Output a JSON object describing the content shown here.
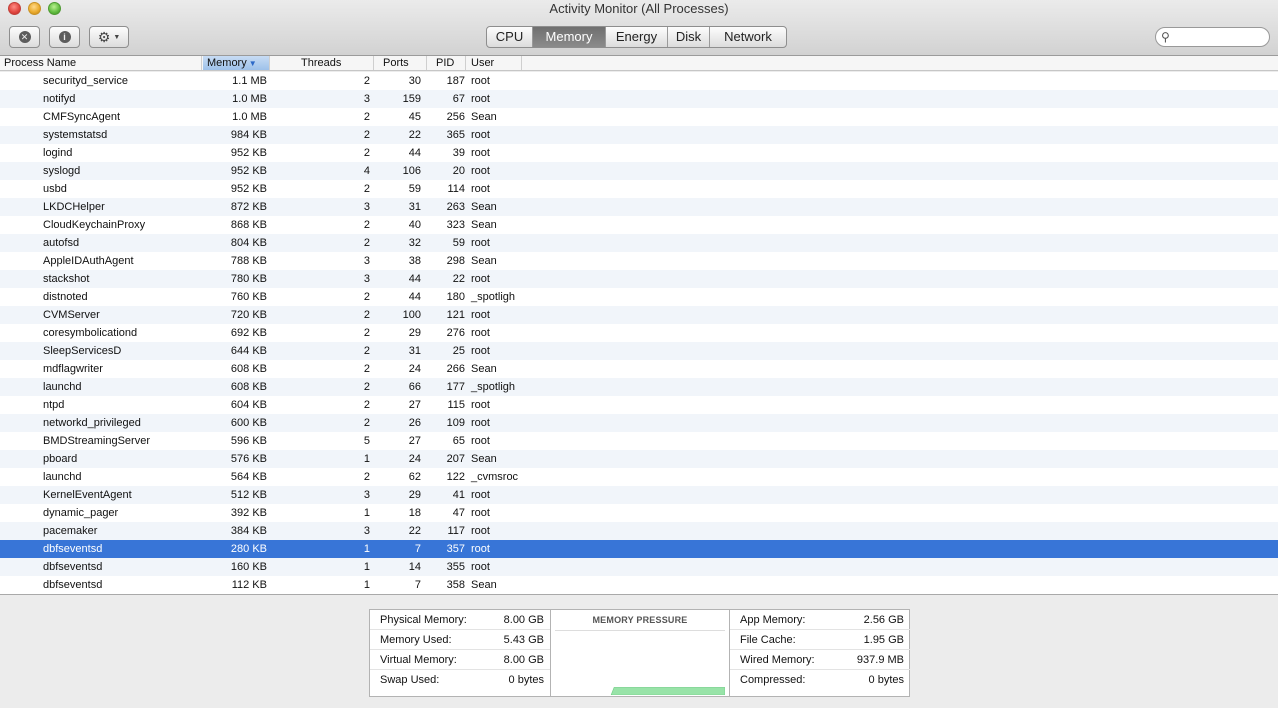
{
  "window": {
    "title": "Activity Monitor (All Processes)"
  },
  "toolbar": {
    "stop_icon": "stop-process-icon",
    "info_icon": "info-icon",
    "gear_icon": "gear-icon",
    "tabs": [
      "CPU",
      "Memory",
      "Energy",
      "Disk",
      "Network"
    ],
    "selected_tab": "Memory",
    "search": {
      "placeholder": "",
      "value": ""
    }
  },
  "table": {
    "columns": {
      "name": "Process Name",
      "memory": "Memory",
      "threads": "Threads",
      "ports": "Ports",
      "pid": "PID",
      "user": "User"
    },
    "sort_column": "Memory",
    "sort_direction": "descending",
    "selected_row": 26,
    "rows": [
      {
        "name": "securityd_service",
        "memory": "1.1 MB",
        "threads": "2",
        "ports": "30",
        "pid": "187",
        "user": "root"
      },
      {
        "name": "notifyd",
        "memory": "1.0 MB",
        "threads": "3",
        "ports": "159",
        "pid": "67",
        "user": "root"
      },
      {
        "name": "CMFSyncAgent",
        "memory": "1.0 MB",
        "threads": "2",
        "ports": "45",
        "pid": "256",
        "user": "Sean"
      },
      {
        "name": "systemstatsd",
        "memory": "984 KB",
        "threads": "2",
        "ports": "22",
        "pid": "365",
        "user": "root"
      },
      {
        "name": "logind",
        "memory": "952 KB",
        "threads": "2",
        "ports": "44",
        "pid": "39",
        "user": "root"
      },
      {
        "name": "syslogd",
        "memory": "952 KB",
        "threads": "4",
        "ports": "106",
        "pid": "20",
        "user": "root"
      },
      {
        "name": "usbd",
        "memory": "952 KB",
        "threads": "2",
        "ports": "59",
        "pid": "114",
        "user": "root"
      },
      {
        "name": "LKDCHelper",
        "memory": "872 KB",
        "threads": "3",
        "ports": "31",
        "pid": "263",
        "user": "Sean"
      },
      {
        "name": "CloudKeychainProxy",
        "memory": "868 KB",
        "threads": "2",
        "ports": "40",
        "pid": "323",
        "user": "Sean"
      },
      {
        "name": "autofsd",
        "memory": "804 KB",
        "threads": "2",
        "ports": "32",
        "pid": "59",
        "user": "root"
      },
      {
        "name": "AppleIDAuthAgent",
        "memory": "788 KB",
        "threads": "3",
        "ports": "38",
        "pid": "298",
        "user": "Sean"
      },
      {
        "name": "stackshot",
        "memory": "780 KB",
        "threads": "3",
        "ports": "44",
        "pid": "22",
        "user": "root"
      },
      {
        "name": "distnoted",
        "memory": "760 KB",
        "threads": "2",
        "ports": "44",
        "pid": "180",
        "user": "_spotligh"
      },
      {
        "name": "CVMServer",
        "memory": "720 KB",
        "threads": "2",
        "ports": "100",
        "pid": "121",
        "user": "root"
      },
      {
        "name": "coresymbolicationd",
        "memory": "692 KB",
        "threads": "2",
        "ports": "29",
        "pid": "276",
        "user": "root"
      },
      {
        "name": "SleepServicesD",
        "memory": "644 KB",
        "threads": "2",
        "ports": "31",
        "pid": "25",
        "user": "root"
      },
      {
        "name": "mdflagwriter",
        "memory": "608 KB",
        "threads": "2",
        "ports": "24",
        "pid": "266",
        "user": "Sean"
      },
      {
        "name": "launchd",
        "memory": "608 KB",
        "threads": "2",
        "ports": "66",
        "pid": "177",
        "user": "_spotligh"
      },
      {
        "name": "ntpd",
        "memory": "604 KB",
        "threads": "2",
        "ports": "27",
        "pid": "115",
        "user": "root"
      },
      {
        "name": "networkd_privileged",
        "memory": "600 KB",
        "threads": "2",
        "ports": "26",
        "pid": "109",
        "user": "root"
      },
      {
        "name": "BMDStreamingServer",
        "memory": "596 KB",
        "threads": "5",
        "ports": "27",
        "pid": "65",
        "user": "root"
      },
      {
        "name": "pboard",
        "memory": "576 KB",
        "threads": "1",
        "ports": "24",
        "pid": "207",
        "user": "Sean"
      },
      {
        "name": "launchd",
        "memory": "564 KB",
        "threads": "2",
        "ports": "62",
        "pid": "122",
        "user": "_cvmsroc"
      },
      {
        "name": "KernelEventAgent",
        "memory": "512 KB",
        "threads": "3",
        "ports": "29",
        "pid": "41",
        "user": "root"
      },
      {
        "name": "dynamic_pager",
        "memory": "392 KB",
        "threads": "1",
        "ports": "18",
        "pid": "47",
        "user": "root"
      },
      {
        "name": "pacemaker",
        "memory": "384 KB",
        "threads": "3",
        "ports": "22",
        "pid": "117",
        "user": "root"
      },
      {
        "name": "dbfseventsd",
        "memory": "280 KB",
        "threads": "1",
        "ports": "7",
        "pid": "357",
        "user": "root"
      },
      {
        "name": "dbfseventsd",
        "memory": "160 KB",
        "threads": "1",
        "ports": "14",
        "pid": "355",
        "user": "root"
      },
      {
        "name": "dbfseventsd",
        "memory": "112 KB",
        "threads": "1",
        "ports": "7",
        "pid": "358",
        "user": "Sean"
      }
    ]
  },
  "memory_panel": {
    "left": [
      {
        "label": "Physical Memory:",
        "value": "8.00 GB"
      },
      {
        "label": "Memory Used:",
        "value": "5.43 GB"
      },
      {
        "label": "Virtual Memory:",
        "value": "8.00 GB"
      },
      {
        "label": "Swap Used:",
        "value": "0 bytes"
      }
    ],
    "pressure_title": "MEMORY PRESSURE",
    "pressure_level": 0.12,
    "pressure_color": "#98e3a8",
    "right": [
      {
        "label": "App Memory:",
        "value": "2.56 GB"
      },
      {
        "label": "File Cache:",
        "value": "1.95 GB"
      },
      {
        "label": "Wired Memory:",
        "value": "937.9 MB"
      },
      {
        "label": "Compressed:",
        "value": "0 bytes"
      }
    ]
  },
  "colors": {
    "selection": "#3875d7",
    "sorted_header": "#9dc1ea",
    "selected_tab": "#7a7a7a"
  }
}
